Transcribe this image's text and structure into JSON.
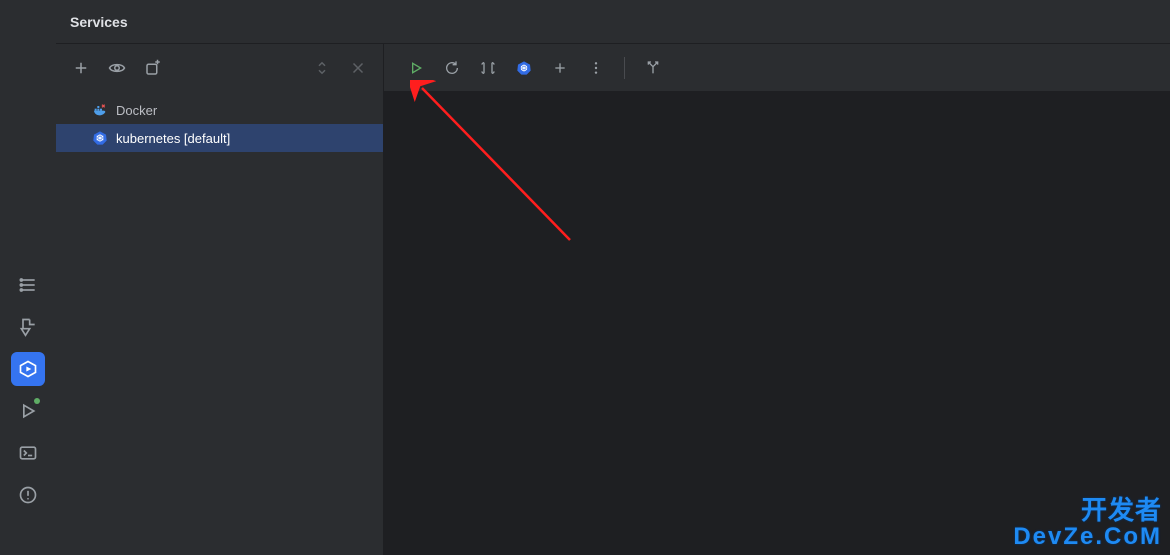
{
  "header": {
    "title": "Services"
  },
  "tree": {
    "items": [
      {
        "label": "Docker",
        "icon": "docker",
        "selected": false
      },
      {
        "label": "kubernetes [default]",
        "icon": "kubernetes",
        "selected": true
      }
    ]
  },
  "panelToolbar": {
    "add": "add-service-icon",
    "visibility": "visibility-icon",
    "newTab": "new-tab-icon",
    "upDown": "sort-icon",
    "close": "close-icon"
  },
  "contentToolbar": {
    "run": "run-icon",
    "refresh": "refresh-icon",
    "namespaces": "namespaces-icon",
    "kubernetes": "kubernetes-context-icon",
    "add": "add-icon",
    "more": "more-icon",
    "portForward": "port-forward-icon"
  },
  "activityBar": {
    "structure": "structure-icon",
    "build": "build-icon",
    "services": "services-icon",
    "run": "run-tool-icon",
    "terminal": "terminal-icon",
    "problems": "problems-icon"
  },
  "watermark": {
    "line1": "开发者",
    "line2": "DevZe.CoM"
  }
}
